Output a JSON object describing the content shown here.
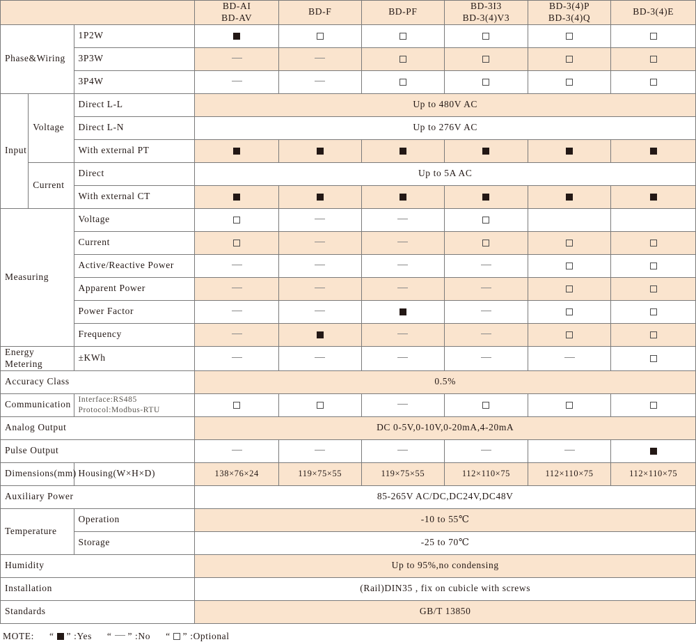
{
  "legend": {
    "prefix": "MOTE:",
    "items": [
      {
        "symbol": "yes",
        "quote_open": "“",
        "quote_close": "”",
        "label": ":Yes"
      },
      {
        "symbol": "no",
        "quote_open": "“",
        "quote_close": "”",
        "label": ":No"
      },
      {
        "symbol": "opt",
        "quote_open": "“",
        "quote_close": "”",
        "label": ":Optional"
      }
    ]
  },
  "colors": {
    "shade": "#fae4ce",
    "ink": "#231815",
    "grid": "#7a7a7a"
  },
  "columns": [
    {
      "line1": "BD-AI",
      "line2": "BD-AV"
    },
    {
      "line1": "BD-F",
      "line2": ""
    },
    {
      "line1": "BD-PF",
      "line2": ""
    },
    {
      "line1": "BD-3I3",
      "line2": "BD-3(4)V3"
    },
    {
      "line1": "BD-3(4)P",
      "line2": "BD-3(4)Q"
    },
    {
      "line1": "BD-3(4)E",
      "line2": ""
    }
  ],
  "sections": {
    "phase_wiring": {
      "label": "Phase&Wiring",
      "rows": [
        {
          "detail": "1P2W",
          "shaded": false,
          "cells": [
            "yes",
            "opt",
            "opt",
            "opt",
            "opt",
            "opt"
          ]
        },
        {
          "detail": "3P3W",
          "shaded": true,
          "cells": [
            "no",
            "no",
            "opt",
            "opt",
            "opt",
            "opt"
          ]
        },
        {
          "detail": "3P4W",
          "shaded": false,
          "cells": [
            "no",
            "no",
            "opt",
            "opt",
            "opt",
            "opt"
          ]
        }
      ]
    },
    "input": {
      "label": "Input",
      "groups": [
        {
          "label": "Voltage",
          "rows": [
            {
              "detail": "Direct L-L",
              "shaded": true,
              "span_text": "Up to 480V AC"
            },
            {
              "detail": "Direct L-N",
              "shaded": false,
              "span_text": "Up to 276V AC"
            },
            {
              "detail": "With external PT",
              "shaded": true,
              "cells": [
                "yes",
                "yes",
                "yes",
                "yes",
                "yes",
                "yes"
              ]
            }
          ]
        },
        {
          "label": "Current",
          "rows": [
            {
              "detail": "Direct",
              "shaded": false,
              "span_text": "Up to 5A AC"
            },
            {
              "detail": "With external CT",
              "shaded": true,
              "cells": [
                "yes",
                "yes",
                "yes",
                "yes",
                "yes",
                "yes"
              ]
            }
          ]
        }
      ]
    },
    "measuring": {
      "label": "Measuring",
      "rows": [
        {
          "detail": "Voltage",
          "shaded": false,
          "cells": [
            "opt",
            "no",
            "no",
            "opt",
            "",
            ""
          ]
        },
        {
          "detail": "Current",
          "shaded": true,
          "cells": [
            "opt",
            "no",
            "no",
            "opt",
            "opt",
            "opt"
          ]
        },
        {
          "detail": "Active/Reactive Power",
          "shaded": false,
          "cells": [
            "no",
            "no",
            "no",
            "no",
            "opt",
            "opt"
          ]
        },
        {
          "detail": "Apparent Power",
          "shaded": true,
          "cells": [
            "no",
            "no",
            "no",
            "no",
            "opt",
            "opt"
          ]
        },
        {
          "detail": "Power Factor",
          "shaded": false,
          "cells": [
            "no",
            "no",
            "yes",
            "no",
            "opt",
            "opt"
          ]
        },
        {
          "detail": "Frequency",
          "shaded": true,
          "cells": [
            "no",
            "yes",
            "no",
            "no",
            "opt",
            "opt"
          ]
        }
      ]
    },
    "tail_rows": [
      {
        "label": "Energy Metering",
        "detail": "±KWh",
        "shaded": false,
        "cells": [
          "no",
          "no",
          "no",
          "no",
          "no",
          "opt"
        ]
      },
      {
        "label": "Accuracy Class",
        "detail": "",
        "shaded": true,
        "span_text": "0.5%"
      },
      {
        "label": "Communication",
        "detail_lines": [
          "Interface:RS485",
          "Protocol:Modbus-RTU"
        ],
        "shaded": false,
        "cells": [
          "opt",
          "opt",
          "no",
          "opt",
          "opt",
          "opt"
        ]
      },
      {
        "label": "Analog Output",
        "detail": "",
        "shaded": true,
        "span_text": "DC 0-5V,0-10V,0-20mA,4-20mA"
      },
      {
        "label": "Pulse Output",
        "detail": "",
        "shaded": false,
        "cells": [
          "no",
          "no",
          "no",
          "no",
          "no",
          "yes"
        ]
      },
      {
        "label": "Dimensions(mm)",
        "detail": "Housing(W×H×D)",
        "shaded": true,
        "values": [
          "138×76×24",
          "119×75×55",
          "119×75×55",
          "112×110×75",
          "112×110×75",
          "112×110×75"
        ]
      },
      {
        "label": "Auxiliary Power",
        "detail": "",
        "shaded": false,
        "span_text": "85-265V AC/DC,DC24V,DC48V"
      }
    ],
    "temperature": {
      "label": "Temperature",
      "rows": [
        {
          "detail": "Operation",
          "shaded": true,
          "span_text": "-10 to 55℃"
        },
        {
          "detail": "Storage",
          "shaded": false,
          "span_text": "-25 to 70℃"
        }
      ]
    },
    "final_rows": [
      {
        "label": "Humidity",
        "shaded": true,
        "span_text": "Up to 95%,no condensing"
      },
      {
        "label": "Installation",
        "shaded": false,
        "span_text": "(Rail)DIN35 , fix on cubicle with screws"
      },
      {
        "label": "Standards",
        "shaded": true,
        "span_text": "GB/T 13850"
      }
    ]
  }
}
